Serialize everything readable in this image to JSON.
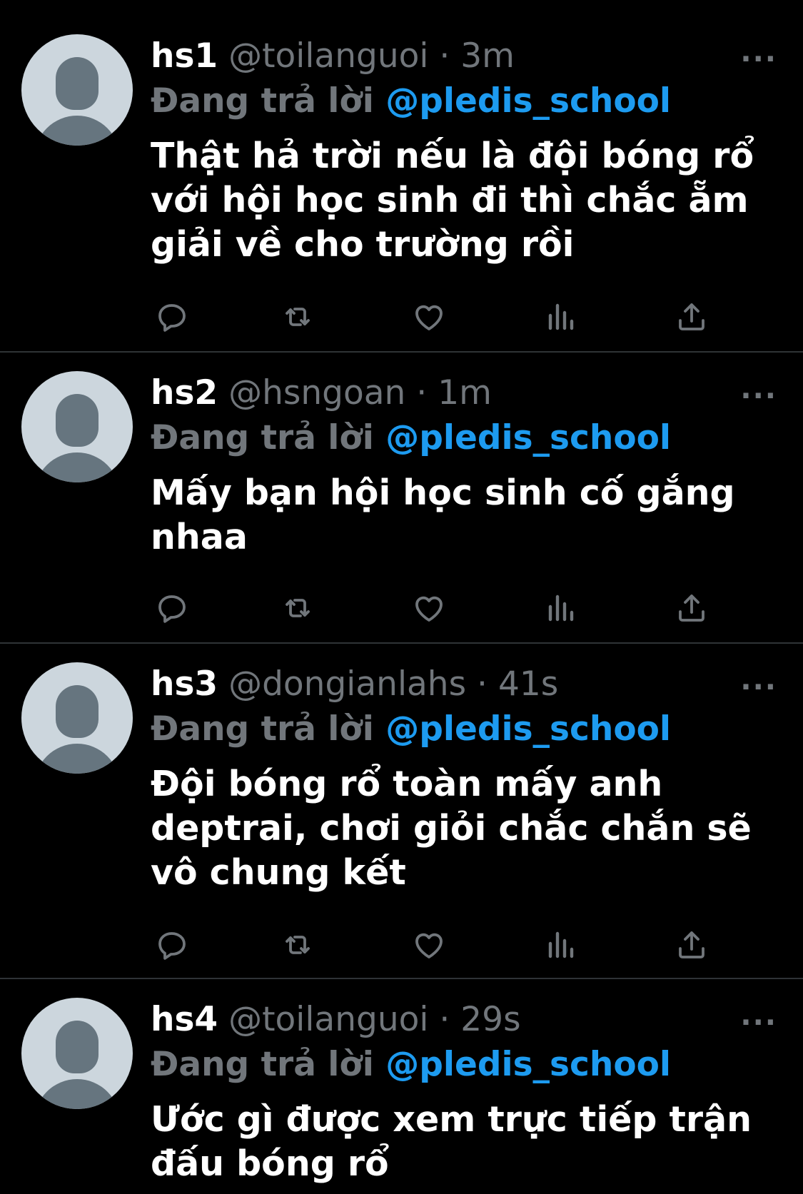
{
  "colors": {
    "background": "#000000",
    "secondary_text": "#71767b",
    "link": "#1d9bf0",
    "divider": "#2f3336",
    "avatar_bg": "#ccd6dd",
    "avatar_fg": "#66757f"
  },
  "tweets": [
    {
      "name": "hs1",
      "handle": "@toilanguoi",
      "dot": "·",
      "time": "3m",
      "reply_prefix": "Đang trả lời",
      "reply_handle": "@pledis_school",
      "text": "Thật hả trời nếu là đội bóng rổ với hội học sinh đi thì chắc ẵm giải về cho trường rồi",
      "more": "···"
    },
    {
      "name": "hs2",
      "handle": "@hsngoan",
      "dot": "·",
      "time": "1m",
      "reply_prefix": "Đang trả lời",
      "reply_handle": "@pledis_school",
      "text": "Mấy bạn hội học sinh cố gắng nhaa",
      "more": "···"
    },
    {
      "name": "hs3",
      "handle": "@dongianlahs",
      "dot": "·",
      "time": "41s",
      "reply_prefix": "Đang trả lời",
      "reply_handle": "@pledis_school",
      "text": "Đội bóng rổ toàn mấy anh deptrai, chơi giỏi chắc chắn sẽ vô chung kết",
      "more": "···"
    },
    {
      "name": "hs4",
      "handle": "@toilanguoi",
      "dot": "·",
      "time": "29s",
      "reply_prefix": "Đang trả lời",
      "reply_handle": "@pledis_school",
      "text": "Ước gì được xem trực tiếp trận đấu bóng rổ",
      "more": "···"
    }
  ],
  "action_icons": [
    "reply-icon",
    "retweet-icon",
    "like-icon",
    "views-icon",
    "share-icon"
  ]
}
